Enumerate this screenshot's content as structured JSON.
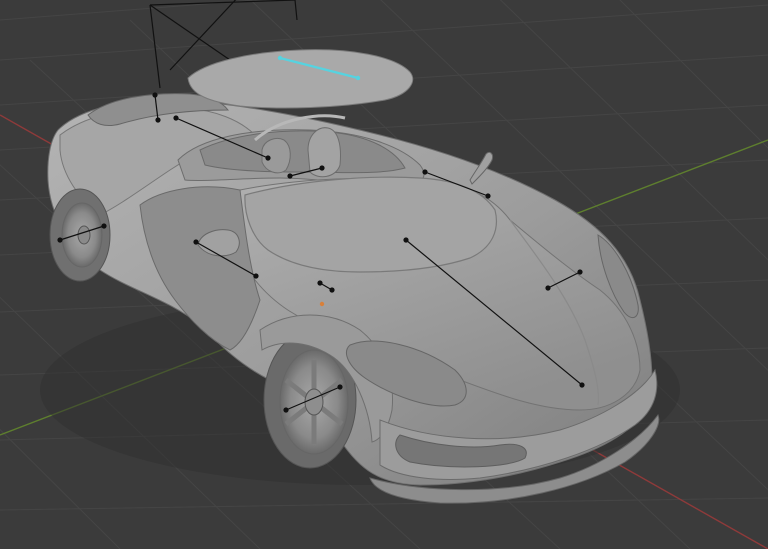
{
  "viewport": {
    "background_color": "#3b3b3b",
    "grid_color": "#454545",
    "x_axis_color": "#8e3a3a",
    "y_axis_color": "#5e7f2e",
    "model_color": "#9e9e9e",
    "selection_color": "#56d3e0",
    "bone_color": "#111111",
    "origin_marker_color": "#d8803a"
  },
  "icons": {
    "camera": "camera-object-icon",
    "object_origin": "object-origin-icon"
  }
}
